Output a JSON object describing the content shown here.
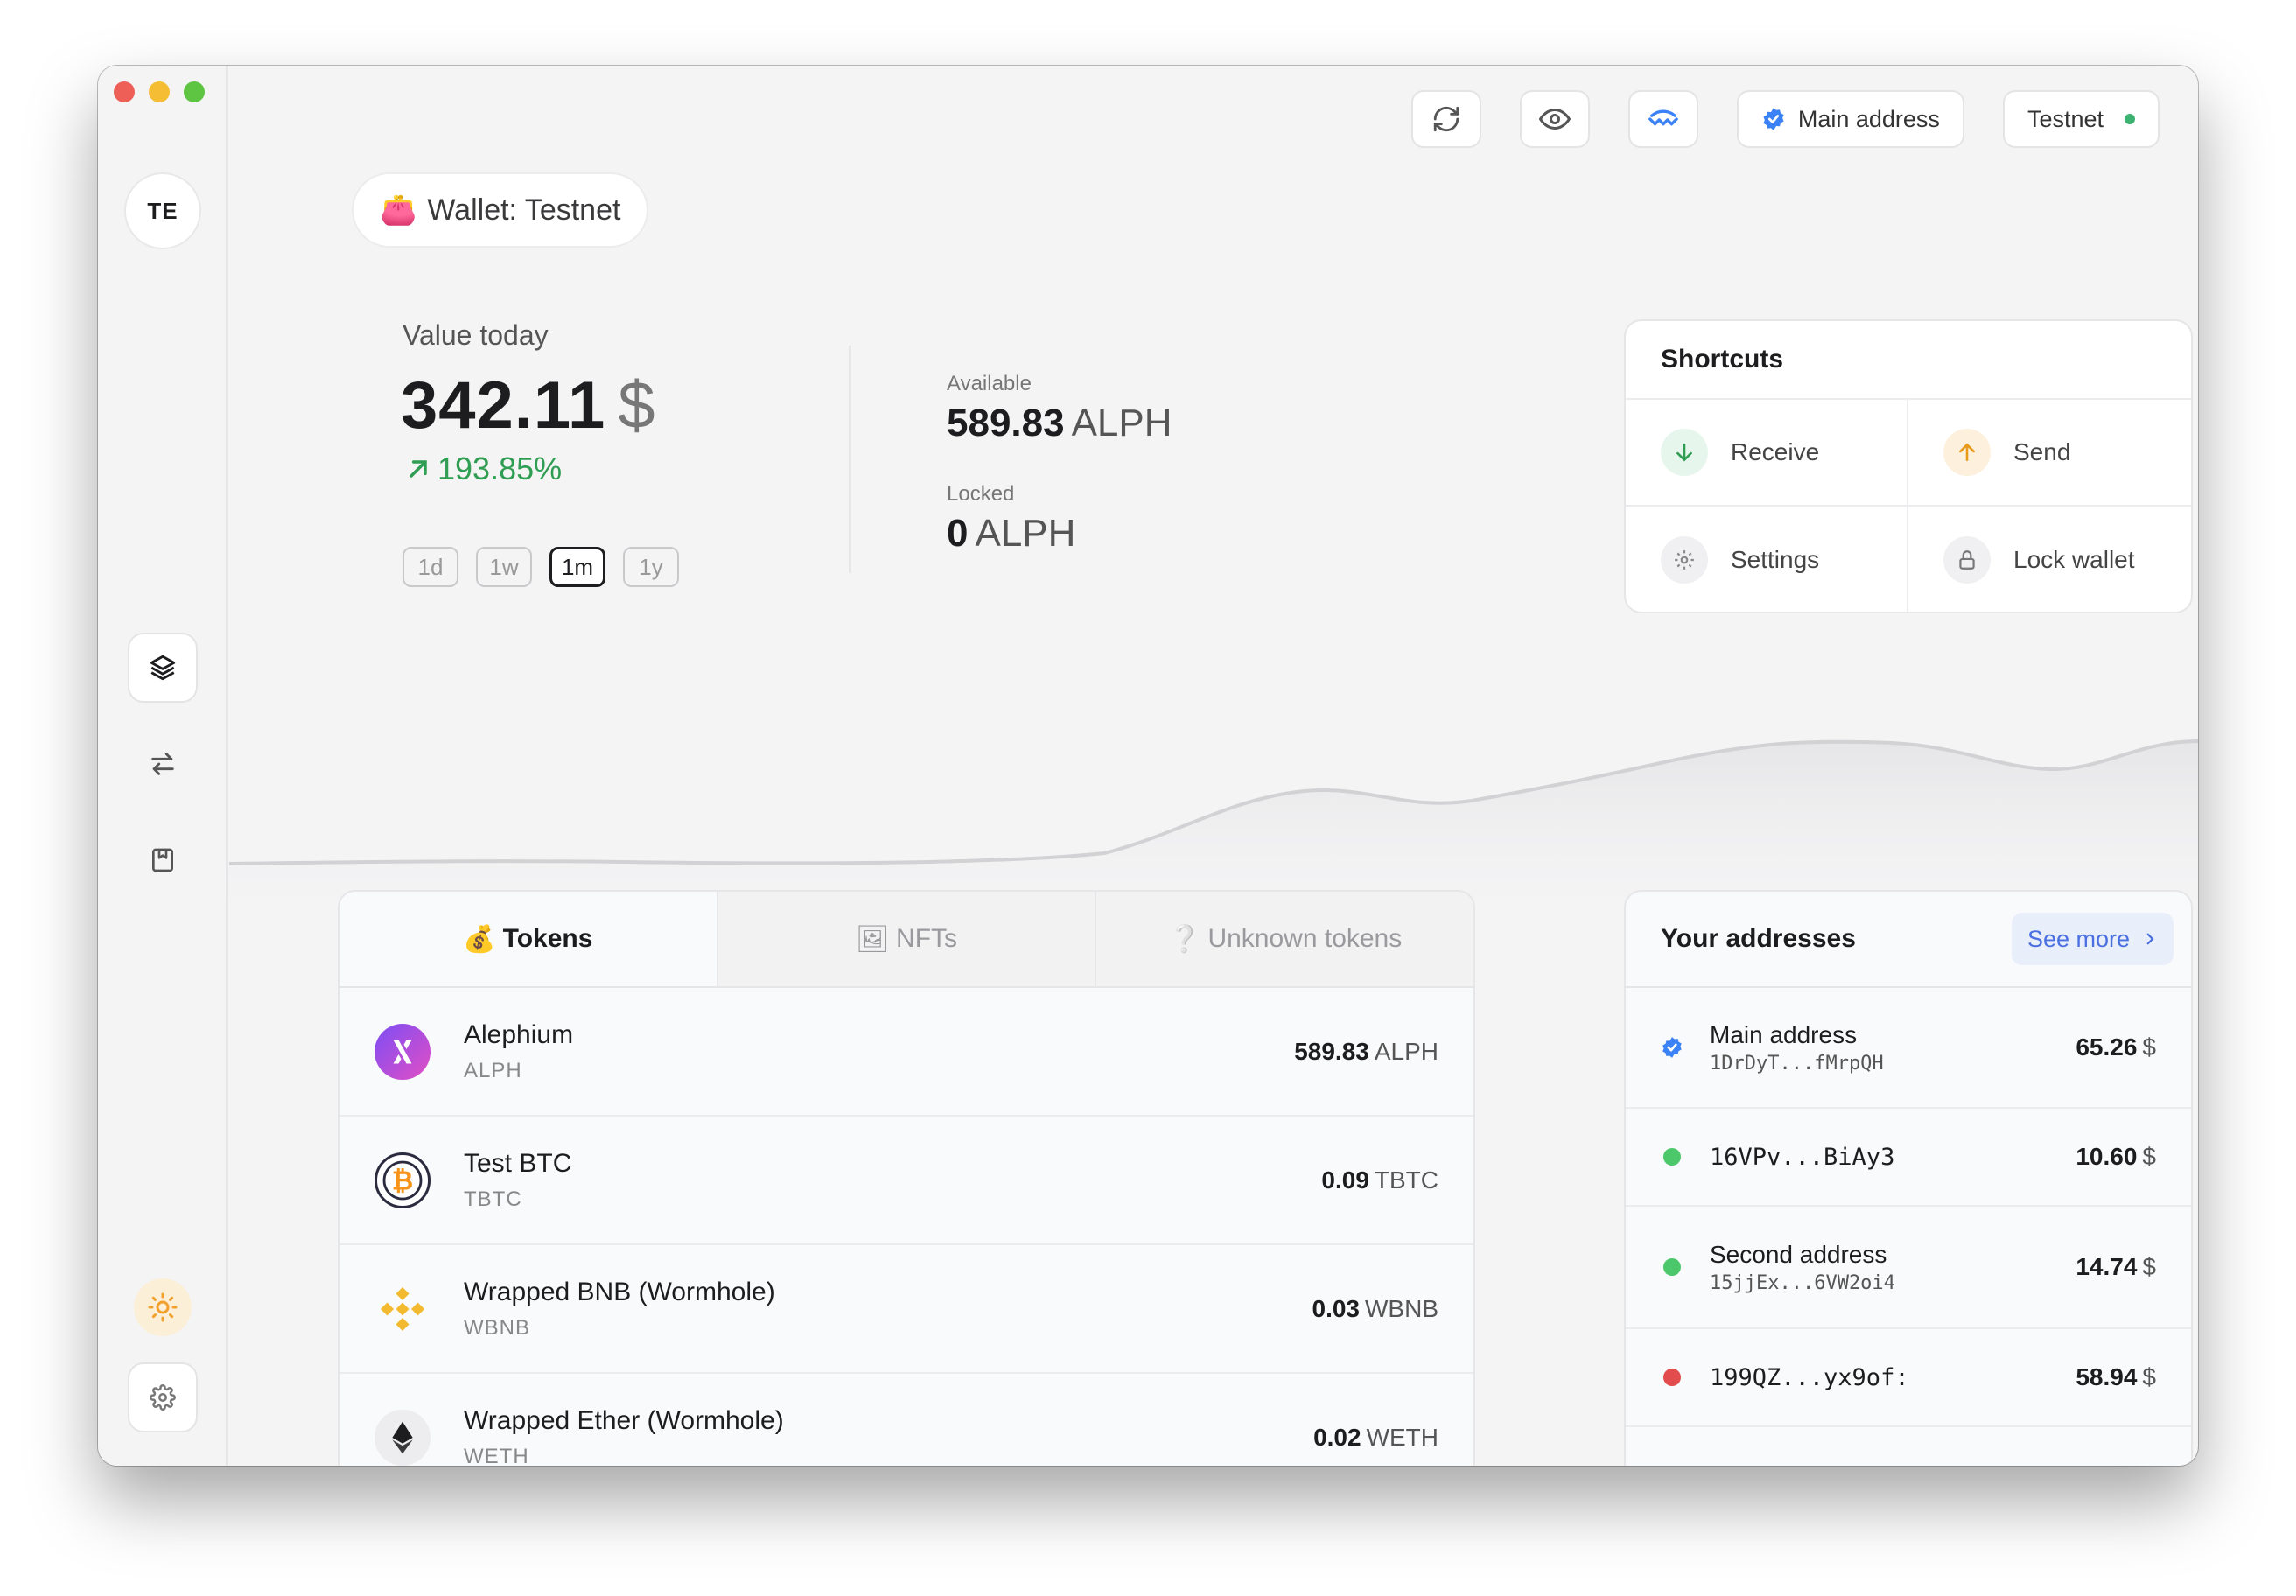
{
  "wallet": {
    "initials": "TE",
    "pill_emoji": "👛",
    "pill_label": "Wallet: Testnet"
  },
  "topbar": {
    "main_address": "Main address",
    "network": "Testnet",
    "network_status_color": "#3cb371",
    "icons": [
      "refresh-icon",
      "eye-icon",
      "walletconnect-icon"
    ]
  },
  "overview": {
    "value_label": "Value today",
    "value_amount": "342.11",
    "value_currency": "$",
    "change": "193.85%",
    "ranges": [
      "1d",
      "1w",
      "1m",
      "1y"
    ],
    "active_range": "1m",
    "available_label": "Available",
    "available_amount": "589.83",
    "available_unit": "ALPH",
    "locked_label": "Locked",
    "locked_amount": "0",
    "locked_unit": "ALPH"
  },
  "shortcuts": {
    "title": "Shortcuts",
    "items": [
      {
        "label": "Receive",
        "icon": "arrow-down-icon"
      },
      {
        "label": "Send",
        "icon": "arrow-up-icon"
      },
      {
        "label": "Settings",
        "icon": "gear-icon"
      },
      {
        "label": "Lock wallet",
        "icon": "lock-icon"
      }
    ]
  },
  "tabs": [
    {
      "emoji": "💰",
      "label": "Tokens"
    },
    {
      "emoji": "🖼",
      "label": "NFTs"
    },
    {
      "emoji": "❔",
      "label": "Unknown tokens"
    }
  ],
  "tokens": [
    {
      "name": "Alephium",
      "symbol": "ALPH",
      "amount": "589.83",
      "unit": "ALPH"
    },
    {
      "name": "Test BTC",
      "symbol": "TBTC",
      "amount": "0.09",
      "unit": "TBTC"
    },
    {
      "name": "Wrapped BNB (Wormhole)",
      "symbol": "WBNB",
      "amount": "0.03",
      "unit": "WBNB"
    },
    {
      "name": "Wrapped Ether (Wormhole)",
      "symbol": "WETH",
      "amount": "0.02",
      "unit": "WETH"
    }
  ],
  "addresses": {
    "title": "Your addresses",
    "see_more": "See more",
    "items": [
      {
        "label": "Main address",
        "hash": "1DrDyT...fMrpQH",
        "value": "65.26",
        "unit": "$",
        "color": "#3b82f6",
        "default": true
      },
      {
        "label": "",
        "hash": "16VPv...BiAy3",
        "value": "10.60",
        "unit": "$",
        "color": "#4cc76a"
      },
      {
        "label": "Second address",
        "hash": "15jjEx...6VW2oi4",
        "value": "14.74",
        "unit": "$",
        "color": "#4cc76a"
      },
      {
        "label": "",
        "hash": "199QZ...yx9of:",
        "value": "58.94",
        "unit": "$",
        "color": "#e24c4c"
      }
    ]
  },
  "colors": {
    "positive": "#2f9e52",
    "accent": "#4a6fe0"
  }
}
